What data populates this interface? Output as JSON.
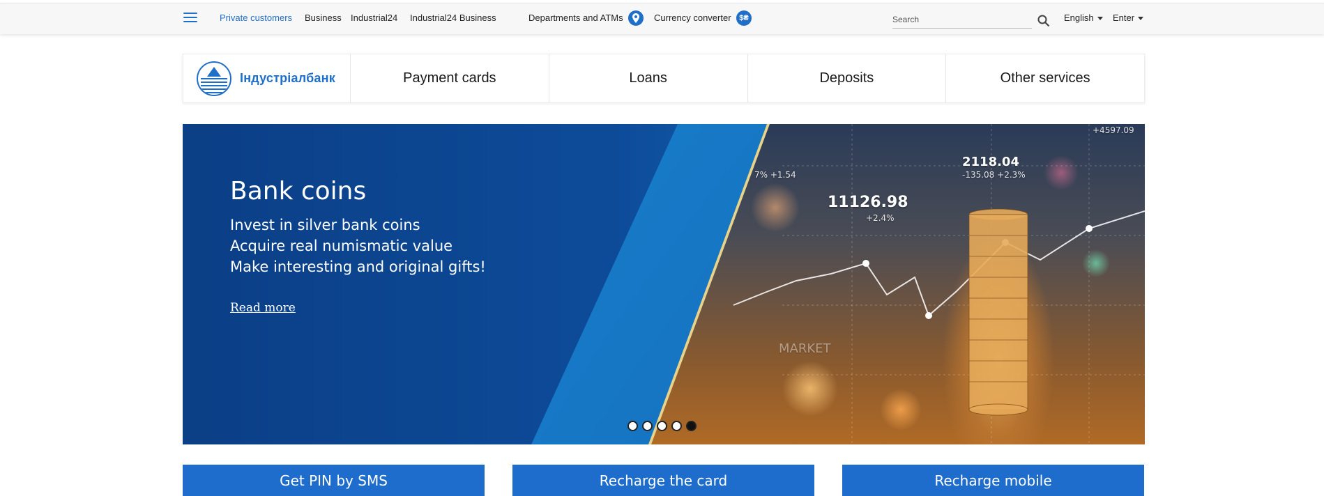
{
  "topbar": {
    "menu_icon": "hamburger-menu-icon",
    "segments": [
      "Private customers",
      "Business",
      "Industrial24",
      "Industrial24 Business"
    ],
    "departments_label": "Departments and ATMs",
    "departments_icon": "location-pin-icon",
    "currency_label": "Currency converter",
    "currency_icon": "currency-exchange-icon",
    "search_placeholder": "Search",
    "search_icon": "search-icon",
    "language": "English",
    "login": "Enter"
  },
  "brand": {
    "name": "Індустріалбанк",
    "color": "#1f6fc9"
  },
  "nav": [
    "Payment cards",
    "Loans",
    "Deposits",
    "Other services"
  ],
  "hero": {
    "title": "Bank coins",
    "lines": [
      "Invest in silver bank coins",
      "Acquire real numismatic value",
      "Make interesting and original gifts!"
    ],
    "link": "Read more",
    "overlay": {
      "big_value": "11126.98",
      "big_change": "+2.4%",
      "mid_value": "2118.04",
      "mid_change": "-135.08 +2.3%",
      "top_right": "+4597.09",
      "small_left": "7% +1.54",
      "market": "MARKET"
    },
    "slides_total": 5,
    "active_slide": 5
  },
  "actions": [
    "Get PIN by SMS",
    "Recharge the card",
    "Recharge mobile"
  ],
  "colors": {
    "accent": "#1f6fc9",
    "button": "#1e6dcc",
    "hero_dark": "#0b3f86"
  }
}
